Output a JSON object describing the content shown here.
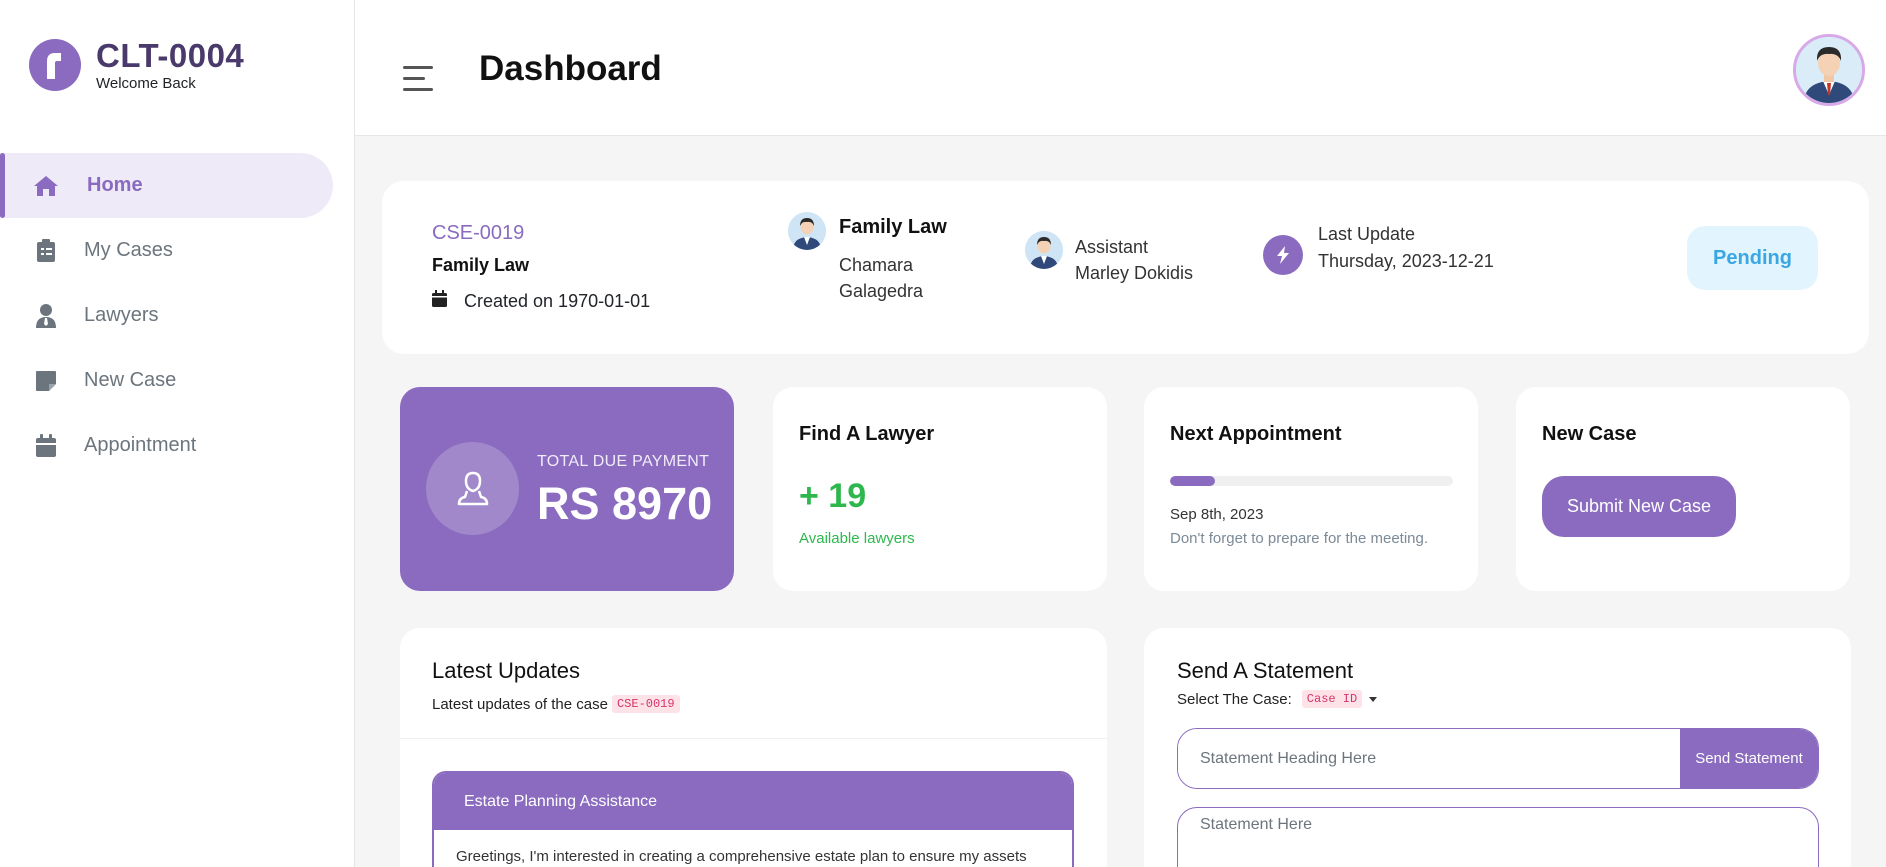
{
  "brand": {
    "title": "CLT-0004",
    "subtitle": "Welcome Back"
  },
  "sidebar": {
    "items": [
      {
        "label": "Home",
        "icon": "home-icon",
        "active": true
      },
      {
        "label": "My Cases",
        "icon": "clipboard-icon"
      },
      {
        "label": "Lawyers",
        "icon": "user-tie-icon"
      },
      {
        "label": "New Case",
        "icon": "sticky-note-icon"
      },
      {
        "label": "Appointment",
        "icon": "calendar-icon"
      }
    ]
  },
  "header": {
    "title": "Dashboard"
  },
  "case": {
    "id": "CSE-0019",
    "type": "Family Law",
    "created": "Created on 1970-01-01",
    "lawyer_title": "Family Law",
    "lawyer_name": "Chamara Galagedra",
    "assistant_label": "Assistant",
    "assistant_name": "Marley Dokidis",
    "last_update_label": "Last Update",
    "last_update_value": "Thursday, 2023-12-21",
    "status": "Pending"
  },
  "stats": {
    "due_label": "TOTAL DUE PAYMENT",
    "due_value": "RS 8970",
    "lawyer_title": "Find A Lawyer",
    "lawyer_count": "+ 19",
    "lawyer_sub": "Available lawyers",
    "appointment_title": "Next Appointment",
    "appointment_progress": 0.16,
    "appointment_date": "Sep 8th, 2023",
    "appointment_note": "Don't forget to prepare for the meeting.",
    "newcase_title": "New Case",
    "newcase_button": "Submit New Case"
  },
  "updates": {
    "title": "Latest Updates",
    "subtitle": "Latest updates of the case",
    "case_chip": "CSE-0019",
    "item_title": "Estate Planning Assistance",
    "item_body": "Greetings, I'm interested in creating a comprehensive estate plan to ensure my assets"
  },
  "statement": {
    "title": "Send A Statement",
    "select_label": "Select The Case:",
    "select_value": "Case ID",
    "heading_placeholder": "Statement Heading Here",
    "send_button": "Send Statement",
    "body_placeholder": "Statement Here"
  },
  "colors": {
    "accent": "#8a6bbf",
    "success": "#2db84d",
    "status": "#3aa7e3"
  }
}
